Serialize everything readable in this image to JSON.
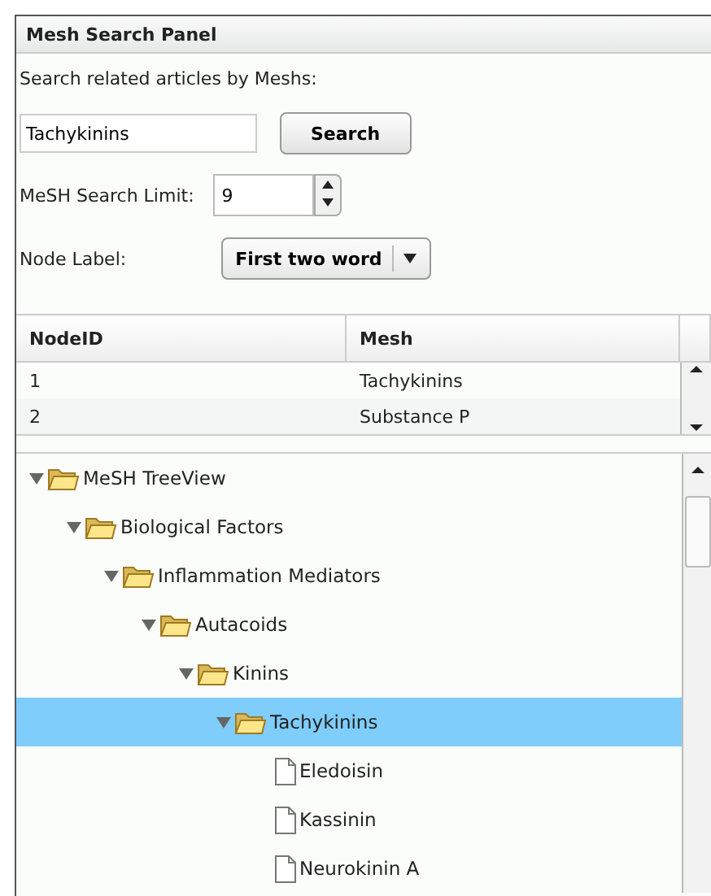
{
  "panel": {
    "title": "Mesh Search Panel"
  },
  "search": {
    "prompt": "Search related articles by Meshs:",
    "value": "Tachykinins",
    "button": "Search"
  },
  "limit": {
    "label": "MeSH Search Limit:",
    "value": "9"
  },
  "node_label": {
    "label": "Node Label:",
    "value": "First two word"
  },
  "table": {
    "columns": [
      "NodeID",
      "Mesh"
    ],
    "rows": [
      {
        "cells": [
          "1",
          "Tachykinins"
        ]
      },
      {
        "cells": [
          "2",
          "Substance P"
        ]
      }
    ]
  },
  "tree": [
    {
      "label": "MeSH TreeView",
      "kind": "folder",
      "expanded": true,
      "selected": false,
      "children": [
        {
          "label": "Biological Factors",
          "kind": "folder",
          "expanded": true,
          "selected": false,
          "children": [
            {
              "label": "Inflammation Mediators",
              "kind": "folder",
              "expanded": true,
              "selected": false,
              "children": [
                {
                  "label": "Autacoids",
                  "kind": "folder",
                  "expanded": true,
                  "selected": false,
                  "children": [
                    {
                      "label": "Kinins",
                      "kind": "folder",
                      "expanded": true,
                      "selected": false,
                      "children": [
                        {
                          "label": "Tachykinins",
                          "kind": "folder",
                          "expanded": true,
                          "selected": true,
                          "children": [
                            {
                              "label": "Eledoisin",
                              "kind": "file",
                              "selected": false
                            },
                            {
                              "label": "Kassinin",
                              "kind": "file",
                              "selected": false
                            },
                            {
                              "label": "Neurokinin A",
                              "kind": "file",
                              "selected": false
                            }
                          ]
                        }
                      ]
                    }
                  ]
                }
              ]
            }
          ]
        }
      ]
    }
  ]
}
